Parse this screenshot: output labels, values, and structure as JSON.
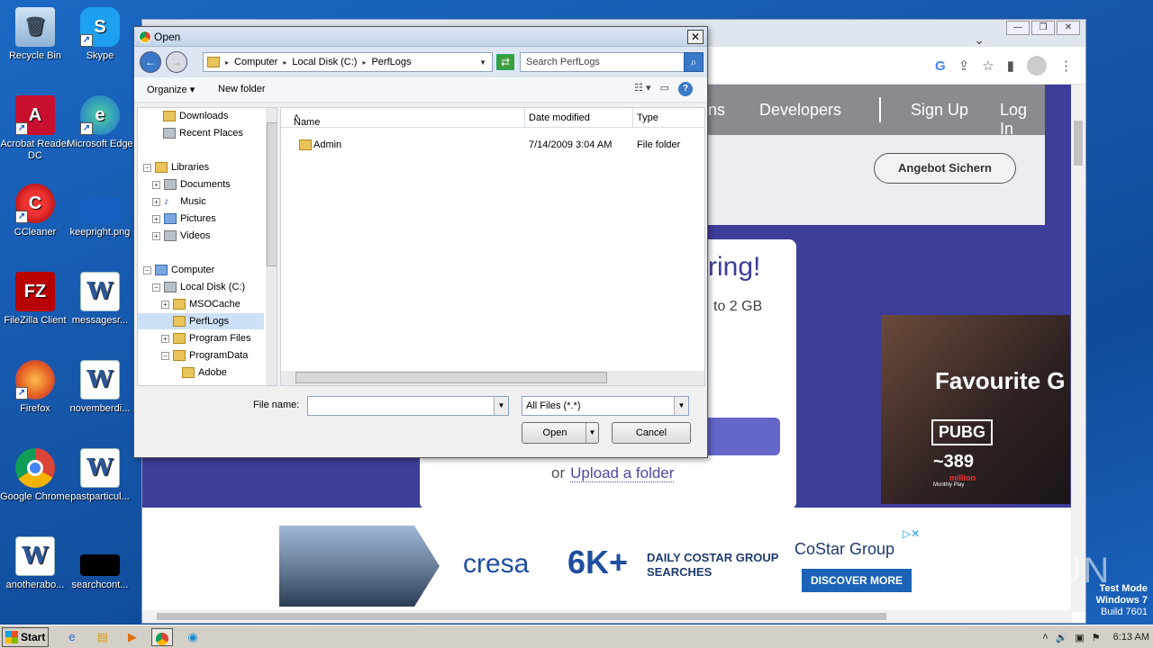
{
  "desktop_icons": [
    {
      "label": "Recycle Bin",
      "icon": "recycle-bin-icon"
    },
    {
      "label": "Skype",
      "icon": "skype-icon"
    },
    {
      "label": "Acrobat Reader DC",
      "icon": "acrobat-icon"
    },
    {
      "label": "Microsoft Edge",
      "icon": "edge-icon"
    },
    {
      "label": "CCleaner",
      "icon": "ccleaner-icon"
    },
    {
      "label": "keepright.png",
      "icon": "image-file-icon"
    },
    {
      "label": "FileZilla Client",
      "icon": "filezilla-icon"
    },
    {
      "label": "messagesr...",
      "icon": "word-doc-icon"
    },
    {
      "label": "Firefox",
      "icon": "firefox-icon"
    },
    {
      "label": "novemberdi...",
      "icon": "word-doc-icon"
    },
    {
      "label": "Google Chrome",
      "icon": "chrome-icon"
    },
    {
      "label": "pastparticul...",
      "icon": "word-doc-icon"
    },
    {
      "label": "anotherabo...",
      "icon": "word-doc-icon"
    },
    {
      "label": "searchcont...",
      "icon": "file-icon"
    }
  ],
  "browser": {
    "nav": {
      "item_partial": "ns",
      "developers": "Developers",
      "signup": "Sign Up",
      "login": "Log In"
    },
    "cta": "Angebot Sichern",
    "card": {
      "headline": "ring!",
      "sub": "to 2 GB",
      "or": "or",
      "upload_folder": "Upload a folder"
    },
    "promo": {
      "title": "Favourite G",
      "brand": "PUBG",
      "number": "~389",
      "million": "million",
      "monthly": "Monthly Play"
    },
    "ad": {
      "cresa": "cresa",
      "big": "6K+",
      "daily_line1": "DAILY COSTAR GROUP",
      "daily_line2": "SEARCHES",
      "costar": "CoStar Group",
      "discover": "DISCOVER MORE"
    }
  },
  "dialog": {
    "title": "Open",
    "breadcrumb": [
      "Computer",
      "Local Disk (C:)",
      "PerfLogs"
    ],
    "search_placeholder": "Search PerfLogs",
    "toolbar": {
      "organize": "Organize",
      "new_folder": "New folder"
    },
    "tree": [
      {
        "label": "Downloads",
        "level": 1
      },
      {
        "label": "Recent Places",
        "level": 1
      },
      {
        "label": "Libraries",
        "level": 0
      },
      {
        "label": "Documents",
        "level": 1
      },
      {
        "label": "Music",
        "level": 1
      },
      {
        "label": "Pictures",
        "level": 1
      },
      {
        "label": "Videos",
        "level": 1
      },
      {
        "label": "Computer",
        "level": 0
      },
      {
        "label": "Local Disk (C:)",
        "level": 1
      },
      {
        "label": "MSOCache",
        "level": 2
      },
      {
        "label": "PerfLogs",
        "level": 2,
        "selected": true
      },
      {
        "label": "Program Files",
        "level": 2
      },
      {
        "label": "ProgramData",
        "level": 2
      },
      {
        "label": "Adobe",
        "level": 3
      }
    ],
    "columns": {
      "name": "Name",
      "date": "Date modified",
      "type": "Type"
    },
    "files": [
      {
        "name": "Admin",
        "date": "7/14/2009 3:04 AM",
        "type": "File folder"
      }
    ],
    "file_name_label": "File name:",
    "file_name_value": "",
    "file_type": "All Files (*.*)",
    "open": "Open",
    "cancel": "Cancel"
  },
  "watermark": "ANY RUN",
  "test_mode": {
    "line1": "Test Mode",
    "line2": "Windows 7",
    "line3": "Build 7601"
  },
  "taskbar": {
    "start": "Start",
    "clock": "6:13 AM"
  }
}
